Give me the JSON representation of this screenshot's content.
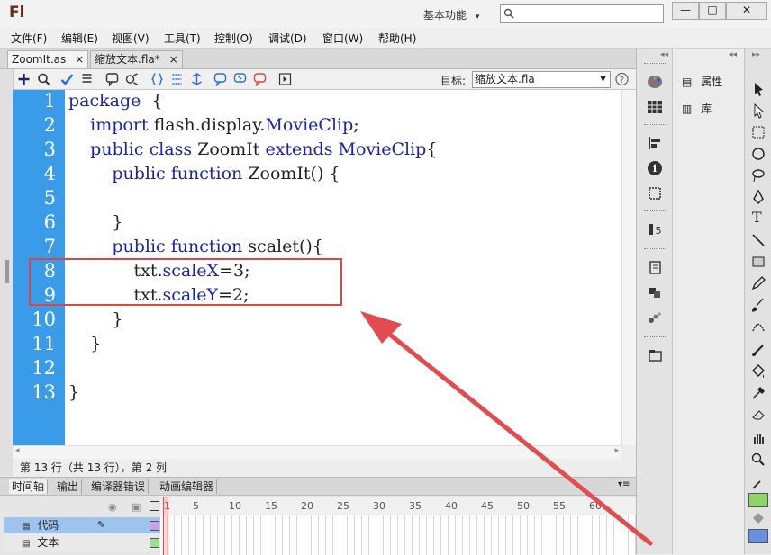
{
  "app": {
    "logo": "Fl",
    "workspace": "基本功能",
    "workspace_caret": "▾"
  },
  "window_controls": {
    "minimize": "—",
    "restore": "□",
    "close": "✕"
  },
  "menu": [
    "文件(F)",
    "编辑(E)",
    "视图(V)",
    "工具(T)",
    "控制(O)",
    "调试(D)",
    "窗口(W)",
    "帮助(H)"
  ],
  "tabs": [
    {
      "label": "ZoomIt.as",
      "close": "×"
    },
    {
      "label": "缩放文本.fla*",
      "close": "×"
    }
  ],
  "toolbar": {
    "target_label": "目标:",
    "target_value": "缩放文本.fla"
  },
  "code_lines": [
    {
      "num": "1",
      "indent": "",
      "parts": [
        [
          "kw",
          "package"
        ],
        [
          "",
          "  {"
        ]
      ]
    },
    {
      "num": "2",
      "indent": "    ",
      "parts": [
        [
          "kw",
          "import"
        ],
        [
          "",
          " flash.display."
        ],
        [
          "kw",
          "MovieClip"
        ],
        [
          "",
          ";"
        ]
      ]
    },
    {
      "num": "3",
      "indent": "    ",
      "parts": [
        [
          "kw",
          "public class"
        ],
        [
          "",
          " ZoomIt "
        ],
        [
          "kw",
          "extends"
        ],
        [
          "",
          " "
        ],
        [
          "kw",
          "MovieClip"
        ],
        [
          "",
          "{"
        ]
      ]
    },
    {
      "num": "4",
      "indent": "        ",
      "parts": [
        [
          "kw",
          "public function"
        ],
        [
          "",
          " ZoomIt() {"
        ]
      ]
    },
    {
      "num": "5",
      "indent": "",
      "parts": []
    },
    {
      "num": "6",
      "indent": "        ",
      "parts": [
        [
          "",
          "}"
        ]
      ]
    },
    {
      "num": "7",
      "indent": "        ",
      "parts": [
        [
          "kw",
          "public function"
        ],
        [
          "",
          " scalet(){"
        ]
      ]
    },
    {
      "num": "8",
      "indent": "            ",
      "parts": [
        [
          "",
          "txt."
        ],
        [
          "kw",
          "scaleX"
        ],
        [
          "",
          "=3;"
        ]
      ]
    },
    {
      "num": "9",
      "indent": "            ",
      "parts": [
        [
          "",
          "txt."
        ],
        [
          "kw",
          "scaleY"
        ],
        [
          "",
          "=2;"
        ]
      ]
    },
    {
      "num": "10",
      "indent": "        ",
      "parts": [
        [
          "",
          "}"
        ]
      ]
    },
    {
      "num": "11",
      "indent": "    ",
      "parts": [
        [
          "",
          "}"
        ]
      ]
    },
    {
      "num": "12",
      "indent": "",
      "parts": []
    },
    {
      "num": "13",
      "indent": "",
      "parts": [
        [
          "",
          "}"
        ]
      ]
    }
  ],
  "status": "第 13 行（共 13 行），第 2 列",
  "timeline": {
    "tabs": [
      "时间轴",
      "输出",
      "编译器错误",
      "动画编辑器"
    ],
    "frame_numbers": [
      "1",
      "5",
      "10",
      "15",
      "20",
      "25",
      "30",
      "35",
      "40",
      "45",
      "50",
      "55",
      "60"
    ],
    "layers": [
      "代码",
      "文本"
    ]
  },
  "panels": {
    "properties": "属性",
    "library": "库"
  },
  "colors": {
    "gutter": "#3a9be8",
    "keyword": "#1a24a8",
    "annotation": "#d9464b"
  }
}
